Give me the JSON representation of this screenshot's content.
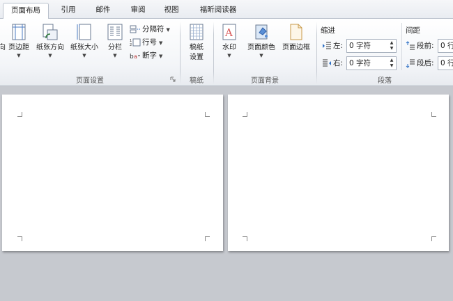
{
  "tabs": [
    "页面布局",
    "引用",
    "邮件",
    "审阅",
    "视图",
    "福昕阅读器"
  ],
  "ribbon": {
    "page_setup": {
      "cut_label": "向",
      "margins": "页边距",
      "orientation": "纸张方向",
      "size": "纸张大小",
      "columns": "分栏",
      "breaks": "分隔符",
      "line_numbers": "行号",
      "hyphenation": "断字",
      "group_label": "页面设置"
    },
    "manuscript": {
      "line1": "稿纸",
      "line2": "设置",
      "group_label": "稿纸"
    },
    "page_background": {
      "watermark": "水印",
      "page_color": "页面颜色",
      "page_borders": "页面边框",
      "group_label": "页面背景"
    },
    "paragraph": {
      "indent_title": "缩进",
      "spacing_title": "间距",
      "left_label": "左:",
      "right_label": "右:",
      "left_value": "0 字符",
      "right_value": "0 字符",
      "before_label": "段前:",
      "after_label": "段后:",
      "before_value": "0 行",
      "after_value": "0 行",
      "group_label": "段落"
    }
  },
  "colors": {
    "page": "#ffffff",
    "workspace": "#c6c9cf",
    "ribbon": "#f3f5f8"
  }
}
